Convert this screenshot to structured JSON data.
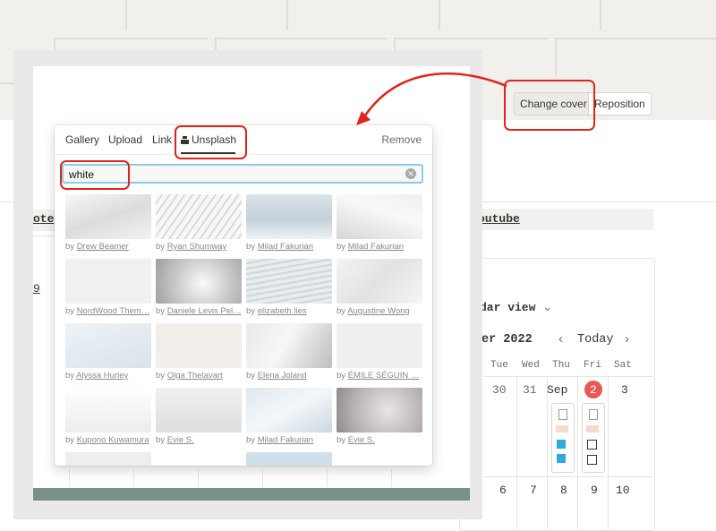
{
  "cover": {
    "change_cover_label": "Change cover",
    "reposition_label": "Reposition"
  },
  "background": {
    "tag_left": "ote",
    "tag_right": "outube",
    "left_number": "9",
    "view_label": "dar view",
    "month": "er 2022",
    "today_label": "Today",
    "weekdays": [
      "Tue",
      "Wed",
      "Thu",
      "Fri",
      "Sat"
    ],
    "days_row1": [
      "30",
      "31",
      "Sep",
      "2",
      "3"
    ],
    "days_row2": [
      "6",
      "7",
      "8",
      "9",
      "10"
    ]
  },
  "picker": {
    "tabs": [
      "Gallery",
      "Upload",
      "Link",
      "Unsplash"
    ],
    "remove_label": "Remove",
    "search_value": "white",
    "images": [
      {
        "by": "by",
        "author": "Drew Beamer"
      },
      {
        "by": "by",
        "author": "Ryan Shumway"
      },
      {
        "by": "by",
        "author": "Milad Fakurian"
      },
      {
        "by": "by",
        "author": "Milad Fakurian"
      },
      {
        "by": "by",
        "author": "NordWood Them…"
      },
      {
        "by": "by",
        "author": "Daniele Levis Pel…"
      },
      {
        "by": "by",
        "author": "elizabeth lies"
      },
      {
        "by": "by",
        "author": "Augustine Wong"
      },
      {
        "by": "by",
        "author": "Alyssa Hurley"
      },
      {
        "by": "by",
        "author": "Olga Thelavart"
      },
      {
        "by": "by",
        "author": "Elena Joland"
      },
      {
        "by": "by",
        "author": "ÉMILE SÉGUIN …"
      },
      {
        "by": "by",
        "author": "Kupono Kuwamura"
      },
      {
        "by": "by",
        "author": "Evie S."
      },
      {
        "by": "by",
        "author": "Milad Fakurian"
      },
      {
        "by": "by",
        "author": "Evie S."
      }
    ]
  },
  "colors": {
    "accent_red": "#e0241a",
    "today_red": "#eb5757",
    "focus_blue": "#8ccbe8",
    "checkbox_blue": "#2eaadc",
    "banner_green": "#7a9187"
  }
}
